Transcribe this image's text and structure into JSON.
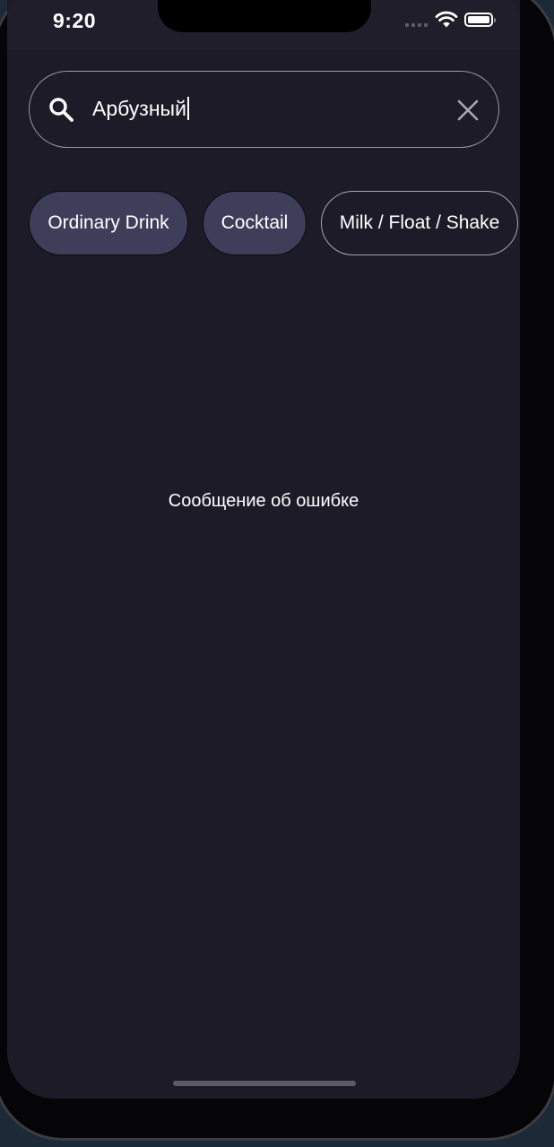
{
  "status_bar": {
    "time": "9:20"
  },
  "search": {
    "value": "Арбузный",
    "icon": "search-icon",
    "clear_icon": "close-icon"
  },
  "filters": [
    {
      "label": "Ordinary Drink",
      "selected": true
    },
    {
      "label": "Cocktail",
      "selected": true
    },
    {
      "label": "Milk / Float / Shake",
      "selected": false
    }
  ],
  "message": "Сообщение об ошибке",
  "colors": {
    "background": "#1d1b28",
    "chip_selected": "#3e3d5a",
    "outline": "#9a98a4",
    "text": "#ffffff"
  }
}
